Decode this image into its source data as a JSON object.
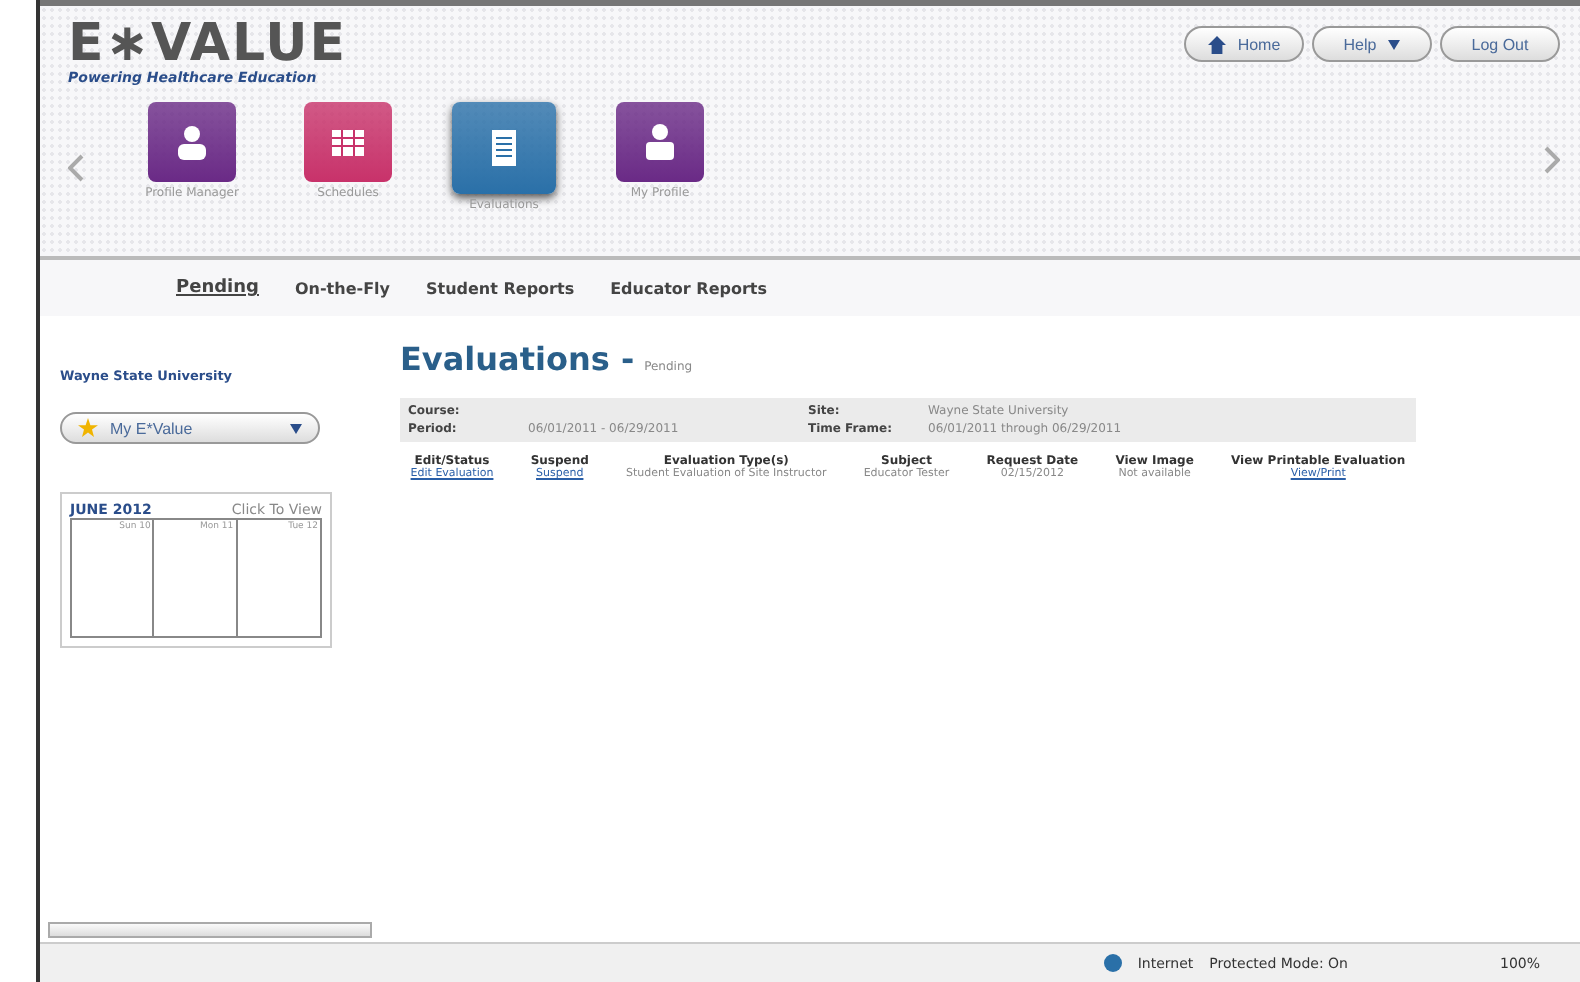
{
  "header": {
    "logo": "E∗VALUE",
    "tagline": "Powering Healthcare Education",
    "buttons": [
      {
        "kind": "home",
        "label": "Home"
      },
      {
        "kind": "menu",
        "label": "Help"
      },
      {
        "kind": "plain",
        "label": "Log Out"
      }
    ]
  },
  "apps": [
    {
      "label": "Profile Manager",
      "kind": "person",
      "color": "#6a2a86",
      "selected": false
    },
    {
      "label": "Schedules",
      "kind": "calendar",
      "color": "#c8326a",
      "selected": false
    },
    {
      "label": "Evaluations",
      "kind": "document",
      "color": "#2a70a8",
      "selected": true
    },
    {
      "label": "My Profile",
      "kind": "badge",
      "color": "#6a2a86",
      "selected": false
    }
  ],
  "tabs": [
    {
      "label": "Pending",
      "selected": true
    },
    {
      "label": "On-the-Fly",
      "selected": false
    },
    {
      "label": "Student Reports",
      "selected": false
    },
    {
      "label": "Educator Reports",
      "selected": false
    }
  ],
  "sidebar": {
    "institution": "Wayne State University",
    "menu": "My E*Value",
    "calendar": {
      "month": "JUNE 2012",
      "link": "Click To View",
      "days": [
        "Sun 10",
        "Mon 11",
        "Tue 12"
      ]
    }
  },
  "main": {
    "title": "Evaluations -",
    "subtitle": "Pending",
    "info": [
      {
        "label": "Course:"
      },
      {
        "label": "Site:",
        "value": "Wayne State University"
      },
      {
        "label": "Period:",
        "value": "06/01/2011 - 06/29/2011"
      },
      {
        "label": "Time Frame:",
        "value": "06/01/2011 through 06/29/2011"
      }
    ],
    "columns": [
      "Edit/Status",
      "Suspend",
      "Evaluation Type(s)",
      "Subject",
      "Request Date",
      "View Image",
      "View Printable Evaluation"
    ],
    "rows": [
      [
        {
          "text": "Edit Evaluation",
          "kind": "link"
        },
        {
          "text": "Suspend",
          "kind": "link"
        },
        {
          "text": "Student Evaluation of Site Instructor",
          "kind": "text"
        },
        {
          "text": "Educator Tester",
          "kind": "text"
        },
        {
          "text": "02/15/2012",
          "kind": "text"
        },
        {
          "text": "Not available",
          "kind": "text"
        },
        {
          "text": "View/Print",
          "kind": "link"
        }
      ]
    ]
  },
  "status_bar": {
    "zone": "Internet",
    "mode": "Protected Mode: On",
    "zoom": "100%"
  }
}
